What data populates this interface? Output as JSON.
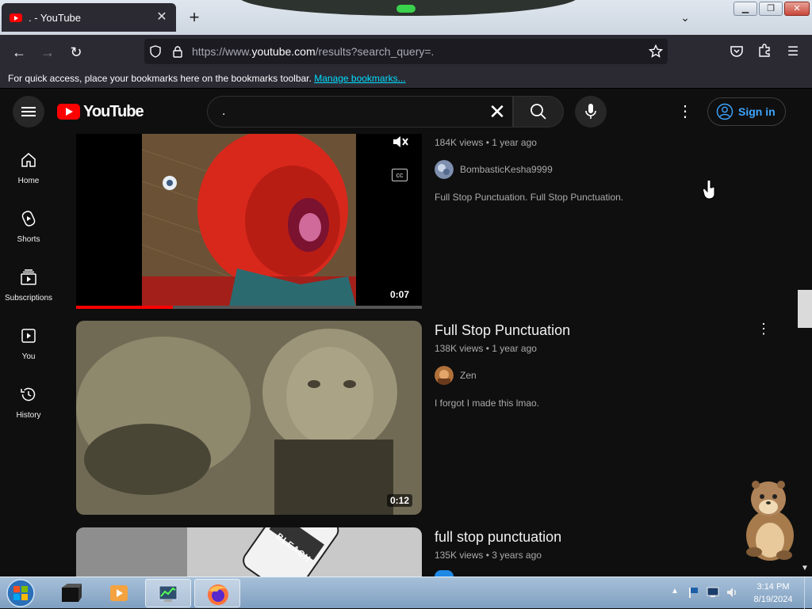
{
  "browser": {
    "tab_title": ". - YouTube",
    "url_prefix": "https://www.",
    "url_host": "youtube.com",
    "url_path": "/results?search_query=.",
    "bookmarks_text": "For quick access, place your bookmarks here on the bookmarks toolbar.",
    "bookmarks_link": "Manage bookmarks..."
  },
  "youtube": {
    "search_value": ".",
    "sign_in": "Sign in",
    "sidebar": [
      {
        "label": "Home",
        "icon": "home-icon"
      },
      {
        "label": "Shorts",
        "icon": "shorts-icon"
      },
      {
        "label": "Subscriptions",
        "icon": "subscriptions-icon"
      },
      {
        "label": "You",
        "icon": "you-icon"
      },
      {
        "label": "History",
        "icon": "history-icon"
      }
    ],
    "results": [
      {
        "title": "",
        "views": "184K views",
        "age": "1 year ago",
        "channel": "BombasticKesha9999",
        "description": "Full Stop Punctuation. Full Stop Punctuation.",
        "duration": "0:07",
        "progress": 0.28
      },
      {
        "title": "Full Stop Punctuation",
        "views": "138K views",
        "age": "1 year ago",
        "channel": "Zen",
        "description": "I forgot I made this lmao.",
        "duration": "0:12"
      },
      {
        "title": "full stop punctuation",
        "views": "135K views",
        "age": "3 years ago",
        "channel": "",
        "description": "",
        "duration": "",
        "thumb_text": "BLEACH"
      }
    ]
  },
  "taskbar": {
    "time": "3:14 PM",
    "date": "8/19/2024"
  },
  "colors": {
    "yt_bg": "#0f0f0f",
    "yt_red": "#ff0000",
    "link_blue": "#3ea6ff"
  }
}
